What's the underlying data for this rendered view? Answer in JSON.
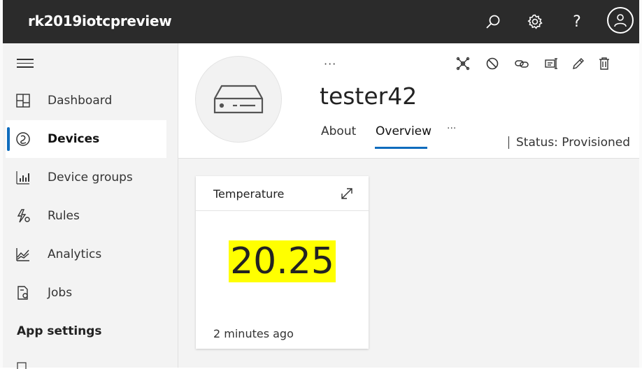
{
  "topbar": {
    "app_title": "rk2019iotcpreview",
    "icons": [
      "search-icon",
      "settings-icon",
      "help-icon",
      "account-icon"
    ],
    "help_glyph": "?"
  },
  "sidebar": {
    "items": [
      {
        "label": "Dashboard",
        "icon": "dashboard-icon",
        "active": false
      },
      {
        "label": "Devices",
        "icon": "devices-icon",
        "active": true
      },
      {
        "label": "Device groups",
        "icon": "device-groups-icon",
        "active": false
      },
      {
        "label": "Rules",
        "icon": "rules-icon",
        "active": false
      },
      {
        "label": "Analytics",
        "icon": "analytics-icon",
        "active": false
      },
      {
        "label": "Jobs",
        "icon": "jobs-icon",
        "active": false
      }
    ],
    "section_title": "App settings"
  },
  "device": {
    "more": "···",
    "name": "tester42",
    "tabs": [
      {
        "label": "About",
        "active": false
      },
      {
        "label": "Overview",
        "active": true
      }
    ],
    "tab_more": "···",
    "status": "Status: Provisioned",
    "actions": [
      "connect-icon",
      "block-icon",
      "link-icon",
      "migrate-icon",
      "edit-icon",
      "delete-icon"
    ]
  },
  "tile": {
    "title": "Temperature",
    "value": "20.25",
    "timestamp": "2 minutes ago"
  },
  "colors": {
    "topbar": "#2b2b2b",
    "accent": "#0f6cbd",
    "highlight": "#ffff00",
    "sidebar": "#f3f3f3"
  }
}
